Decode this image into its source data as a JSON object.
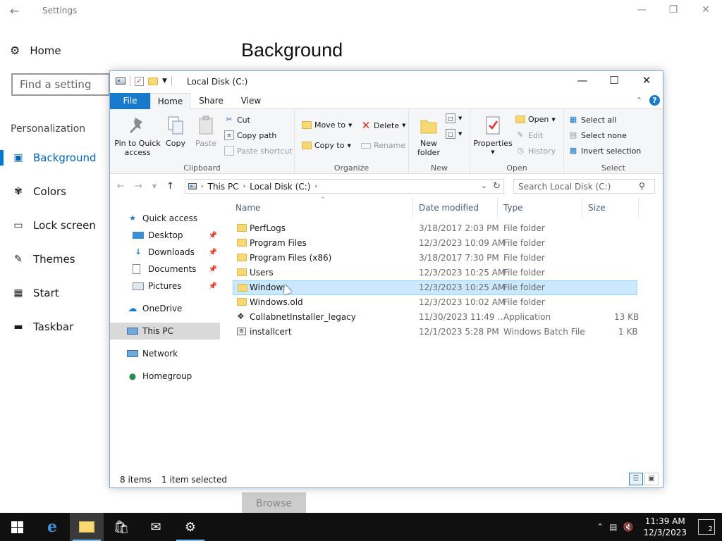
{
  "settings": {
    "title": "Settings",
    "home_label": "Home",
    "search_placeholder": "Find a setting",
    "section_label": "Personalization",
    "heading": "Background",
    "nav": [
      {
        "label": "Background",
        "icon": "picture-icon",
        "active": true
      },
      {
        "label": "Colors",
        "icon": "palette-icon",
        "active": false
      },
      {
        "label": "Lock screen",
        "icon": "lock-screen-icon",
        "active": false
      },
      {
        "label": "Themes",
        "icon": "themes-icon",
        "active": false
      },
      {
        "label": "Start",
        "icon": "start-icon",
        "active": false
      },
      {
        "label": "Taskbar",
        "icon": "taskbar-icon",
        "active": false
      }
    ],
    "browse_label": "Browse"
  },
  "explorer": {
    "title": "Local Disk (C:)",
    "tabs": {
      "file": "File",
      "home": "Home",
      "share": "Share",
      "view": "View"
    },
    "ribbon": {
      "clipboard": {
        "pin": "Pin to Quick access",
        "copy": "Copy",
        "paste": "Paste",
        "cut": "Cut",
        "copy_path": "Copy path",
        "paste_shortcut": "Paste shortcut",
        "label": "Clipboard"
      },
      "organize": {
        "move_to": "Move to",
        "copy_to": "Copy to",
        "delete": "Delete",
        "rename": "Rename",
        "label": "Organize"
      },
      "new": {
        "new_folder": "New folder",
        "label": "New"
      },
      "open": {
        "properties": "Properties",
        "open": "Open",
        "edit": "Edit",
        "history": "History",
        "label": "Open"
      },
      "select": {
        "select_all": "Select all",
        "select_none": "Select none",
        "invert": "Invert selection",
        "label": "Select"
      }
    },
    "address": {
      "path": [
        "This PC",
        "Local Disk (C:)"
      ],
      "search_placeholder": "Search Local Disk (C:)"
    },
    "nav_pane": {
      "quick_access": "Quick access",
      "quick_items": [
        "Desktop",
        "Downloads",
        "Documents",
        "Pictures"
      ],
      "onedrive": "OneDrive",
      "this_pc": "This PC",
      "network": "Network",
      "homegroup": "Homegroup"
    },
    "columns": {
      "name": "Name",
      "date": "Date modified",
      "type": "Type",
      "size": "Size"
    },
    "files": [
      {
        "name": "PerfLogs",
        "date": "3/18/2017 2:03 PM",
        "type": "File folder",
        "size": "",
        "kind": "folder"
      },
      {
        "name": "Program Files",
        "date": "12/3/2023 10:09 AM",
        "type": "File folder",
        "size": "",
        "kind": "folder"
      },
      {
        "name": "Program Files (x86)",
        "date": "3/18/2017 7:30 PM",
        "type": "File folder",
        "size": "",
        "kind": "folder"
      },
      {
        "name": "Users",
        "date": "12/3/2023 10:25 AM",
        "type": "File folder",
        "size": "",
        "kind": "folder"
      },
      {
        "name": "Windows",
        "date": "12/3/2023 10:25 AM",
        "type": "File folder",
        "size": "",
        "kind": "folder",
        "selected": true
      },
      {
        "name": "Windows.old",
        "date": "12/3/2023 10:02 AM",
        "type": "File folder",
        "size": "",
        "kind": "folder"
      },
      {
        "name": "CollabnetInstaller_legacy",
        "date": "11/30/2023 11:49 ...",
        "type": "Application",
        "size": "13 KB",
        "kind": "app"
      },
      {
        "name": "installcert",
        "date": "12/1/2023 5:28 PM",
        "type": "Windows Batch File",
        "size": "1 KB",
        "kind": "batch"
      }
    ],
    "status": {
      "items": "8 items",
      "selected": "1 item selected"
    }
  },
  "taskbar": {
    "time": "11:39 AM",
    "date": "12/3/2023",
    "notifications": "2"
  },
  "colors": {
    "accent": "#0078d7",
    "file_tab": "#1979ca",
    "selection": "#cce8ff",
    "taskbar": "#101010"
  }
}
